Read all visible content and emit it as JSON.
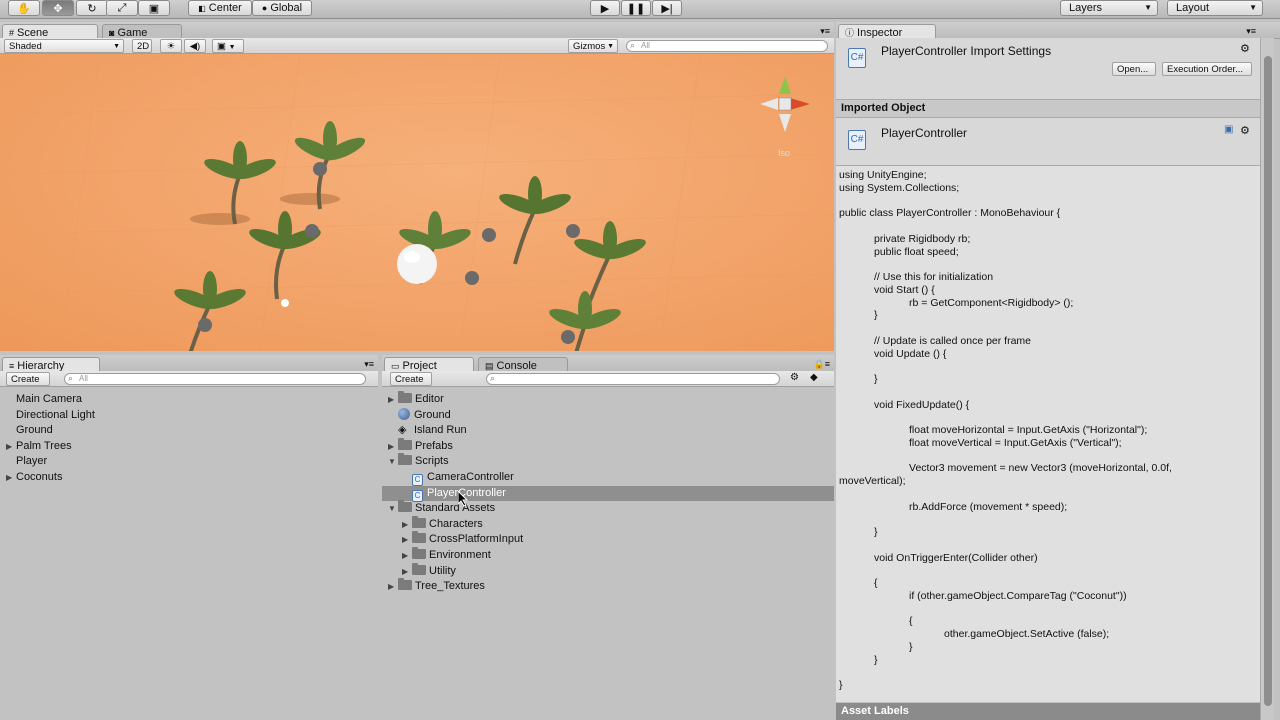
{
  "toolbar": {
    "pivot_label": "Center",
    "space_label": "Global",
    "layers_label": "Layers",
    "layout_label": "Layout"
  },
  "scene_panel": {
    "tabs": [
      {
        "label": "Scene"
      },
      {
        "label": "Game"
      }
    ],
    "shading_mode": "Shaded",
    "mode_2d": "2D",
    "gizmos_label": "Gizmos",
    "search_placeholder": "All",
    "view_label": "Iso"
  },
  "hierarchy": {
    "tab_label": "Hierarchy",
    "create_label": "Create",
    "search_placeholder": "All",
    "items": [
      {
        "label": "Main Camera",
        "expandable": false
      },
      {
        "label": "Directional Light",
        "expandable": false
      },
      {
        "label": "Ground",
        "expandable": false
      },
      {
        "label": "Palm Trees",
        "expandable": true
      },
      {
        "label": "Player",
        "expandable": false
      },
      {
        "label": "Coconuts",
        "expandable": true
      }
    ]
  },
  "project": {
    "tabs": [
      {
        "label": "Project"
      },
      {
        "label": "Console"
      }
    ],
    "create_label": "Create",
    "items": [
      {
        "label": "Editor",
        "depth": 0,
        "kind": "folder",
        "arrow": "right"
      },
      {
        "label": "Ground",
        "depth": 0,
        "kind": "material",
        "arrow": ""
      },
      {
        "label": "Island Run",
        "depth": 0,
        "kind": "scene",
        "arrow": ""
      },
      {
        "label": "Prefabs",
        "depth": 0,
        "kind": "folder",
        "arrow": "right"
      },
      {
        "label": "Scripts",
        "depth": 0,
        "kind": "folder",
        "arrow": "down"
      },
      {
        "label": "CameraController",
        "depth": 1,
        "kind": "script",
        "arrow": ""
      },
      {
        "label": "PlayerController",
        "depth": 1,
        "kind": "script",
        "arrow": "",
        "selected": true
      },
      {
        "label": "Standard Assets",
        "depth": 0,
        "kind": "folder",
        "arrow": "down"
      },
      {
        "label": "Characters",
        "depth": 1,
        "kind": "folder",
        "arrow": "right"
      },
      {
        "label": "CrossPlatformInput",
        "depth": 1,
        "kind": "folder",
        "arrow": "right"
      },
      {
        "label": "Environment",
        "depth": 1,
        "kind": "folder",
        "arrow": "right"
      },
      {
        "label": "Utility",
        "depth": 1,
        "kind": "folder",
        "arrow": "right"
      },
      {
        "label": "Tree_Textures",
        "depth": 0,
        "kind": "folder",
        "arrow": "right"
      }
    ]
  },
  "inspector": {
    "tab_label": "Inspector",
    "title": "PlayerController Import Settings",
    "open_label": "Open...",
    "exec_order_label": "Execution Order...",
    "section_label": "Imported Object",
    "object_name": "PlayerController",
    "asset_labels": "Asset Labels",
    "code_lines": [
      "using UnityEngine;",
      "using System.Collections;",
      "",
      "public class PlayerController : MonoBehaviour {",
      "",
      "            private Rigidbody rb;",
      "            public float speed;",
      "",
      "            // Use this for initialization",
      "            void Start () {",
      "                        rb = GetComponent<Rigidbody> ();",
      "            }",
      "",
      "            // Update is called once per frame",
      "            void Update () {",
      "",
      "            }",
      "",
      "            void FixedUpdate() {",
      "",
      "                        float moveHorizontal = Input.GetAxis (\"Horizontal\");",
      "                        float moveVertical = Input.GetAxis (\"Vertical\");",
      "",
      "                        Vector3 movement = new Vector3 (moveHorizontal, 0.0f,",
      "moveVertical);",
      "",
      "                        rb.AddForce (movement * speed);",
      "",
      "            }",
      "",
      "            void OnTriggerEnter(Collider other)",
      "",
      "            {",
      "                        if (other.gameObject.CompareTag (\"Coconut\"))",
      "",
      "                        {",
      "                                    other.gameObject.SetActive (false);",
      "                        }",
      "            }",
      "",
      "}"
    ]
  },
  "colors": {
    "scene_bg": "#f2a468",
    "selection": "#8f8f8f",
    "panel_bg": "#c2c2c2",
    "inspector_bg": "#d8d8d8"
  }
}
